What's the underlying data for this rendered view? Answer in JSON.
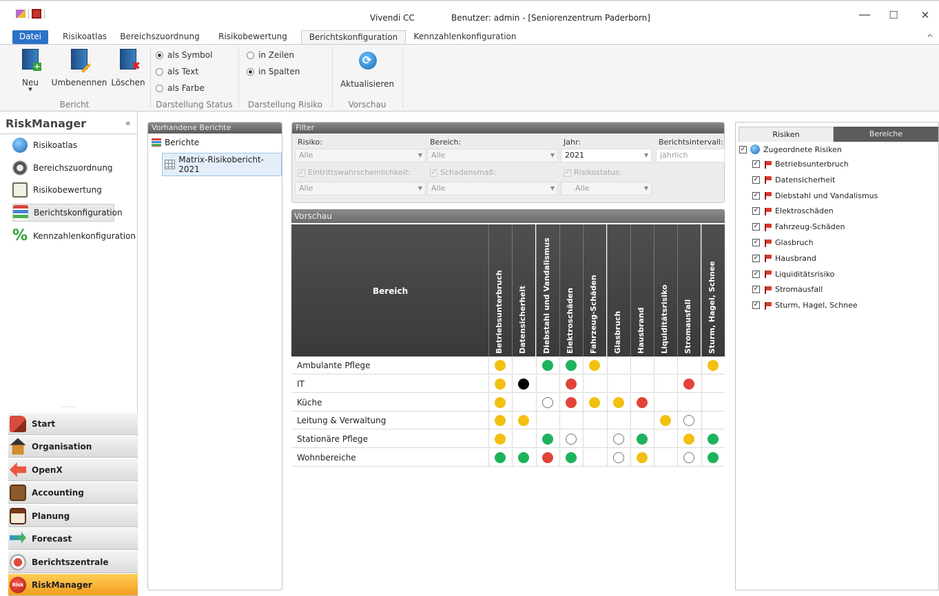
{
  "window": {
    "app": "Vivendi CC",
    "user": "Benutzer: admin - [Seniorenzentrum Paderborn]",
    "minimize": "—",
    "maximize": "☐",
    "close": "✕",
    "collapse": "ᨈ"
  },
  "tabs": [
    "Datei",
    "Risikoatlas",
    "Bereichszuordnung",
    "Risikobewertung",
    "Berichtskonfiguration",
    "Kennzahlenkonfiguration"
  ],
  "ribbon": {
    "new": "Neu",
    "rename": "Umbenennen",
    "delete": "Löschen",
    "group_report": "Bericht",
    "status_symbol": "als Symbol",
    "status_text": "als Text",
    "status_color": "als Farbe",
    "group_status": "Darstellung Status",
    "risk_rows": "in Zeilen",
    "risk_cols": "in Spalten",
    "group_risk": "Darstellung Risiko",
    "refresh": "Aktualisieren",
    "group_preview": "Vorschau"
  },
  "sidebar": {
    "title": "RiskManager",
    "collapse": "«",
    "items": [
      "Risikoatlas",
      "Bereichszuordnung",
      "Risikobewertung",
      "Berichtskonfiguration",
      "Kennzahlenkonfiguration"
    ],
    "nav": [
      "Start",
      "Organisation",
      "OpenX",
      "Accounting",
      "Planung",
      "Forecast",
      "Berichtszentrale",
      "RiskManager"
    ],
    "grip": "·········"
  },
  "reports": {
    "header": "Vorhandene Berichte",
    "root": "Berichte",
    "item": "Matrix-Risikobericht-2021"
  },
  "filter": {
    "header": "Filter",
    "risk_label": "Risiko:",
    "risk_value": "Alle",
    "area_label": "Bereich:",
    "area_value": "Alle",
    "year_label": "Jahr:",
    "year_value": "2021",
    "interval_label": "Berichtsintervall:",
    "interval_value": "jährlich",
    "prob_label": "Eintrittswahrscheinlichkeit:",
    "prob_value": "Alle",
    "damage_label": "Schadensmaß:",
    "damage_value": "Alle",
    "status_label": "Risikostatus:",
    "status_value": "Alle"
  },
  "preview": {
    "header": "Vorschau",
    "area_header": "Bereich",
    "columns": [
      "Betriebsunterbruch",
      "Datensicherheit",
      "Diebstahl und Vandalismus",
      "Elektroschäden",
      "Fahrzeug-Schäden",
      "Glasbruch",
      "Hausbrand",
      "Liquiditätsrisiko",
      "Stromausfall",
      "Sturm, Hagel, Schnee"
    ],
    "rows": [
      {
        "label": "Ambulante Pflege",
        "cells": [
          "y",
          "",
          "g",
          "g",
          "y",
          "",
          "",
          "",
          "",
          "y"
        ]
      },
      {
        "label": "IT",
        "cells": [
          "y",
          "b",
          "",
          "r",
          "",
          "",
          "",
          "",
          "r",
          ""
        ]
      },
      {
        "label": "Küche",
        "cells": [
          "y",
          "",
          "w",
          "r",
          "y",
          "y",
          "r",
          "",
          "",
          ""
        ]
      },
      {
        "label": "Leitung & Verwaltung",
        "cells": [
          "y",
          "y",
          "",
          "",
          "",
          "",
          "",
          "y",
          "w",
          ""
        ]
      },
      {
        "label": "Stationäre Pflege",
        "cells": [
          "y",
          "",
          "g",
          "w",
          "",
          "w",
          "g",
          "",
          "y",
          "g"
        ]
      },
      {
        "label": "Wohnbereiche",
        "cells": [
          "g",
          "g",
          "r",
          "g",
          "",
          "w",
          "y",
          "",
          "w",
          "g"
        ]
      }
    ]
  },
  "right": {
    "tab_risks": "Risiken",
    "tab_areas": "Bereiche",
    "root": "Zugeordnete Risiken",
    "items": [
      "Betriebsunterbruch",
      "Datensicherheit",
      "Diebstahl und Vandalismus",
      "Elektroschäden",
      "Fahrzeug-Schäden",
      "Glasbruch",
      "Hausbrand",
      "Liquiditätsrisiko",
      "Stromausfall",
      "Sturm, Hagel, Schnee"
    ]
  },
  "colors": {
    "yellow": "#f2c010",
    "green": "#1db35d",
    "red": "#e2443a",
    "black": "#000000"
  }
}
